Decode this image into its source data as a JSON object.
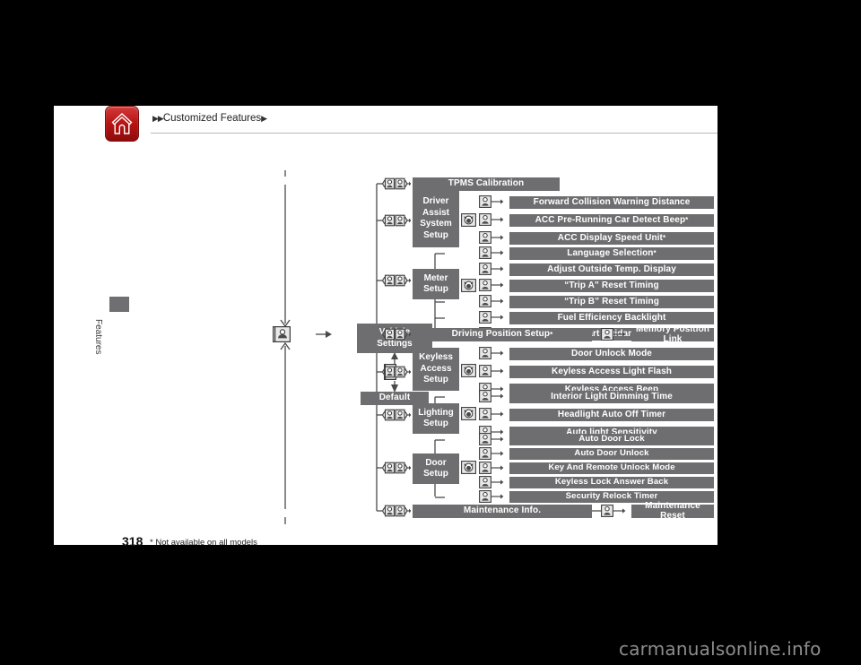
{
  "header": {
    "home_icon": "home-icon",
    "breadcrumb_prefix": "▶▶",
    "breadcrumb": "Customized Features",
    "breadcrumb_suffix": "▶"
  },
  "side_tab": {
    "label": "Features"
  },
  "footer": {
    "page_number": "318",
    "footnote": "* Not available on all models",
    "watermark": "carmanualsonline.info"
  },
  "colors": {
    "bar": "#6e6e70",
    "home_red": "#b81414",
    "line": "#4a4a4a",
    "paper": "#ffffff",
    "backdrop": "#000000"
  },
  "diagram": {
    "root": {
      "label_line1": "Vehicle",
      "label_line2": "Settings"
    },
    "default_node": {
      "label": "Default"
    },
    "branches": [
      {
        "id": "tpms",
        "type": "leaf",
        "label": "TPMS Calibration",
        "footnote_mark": ""
      },
      {
        "id": "driver-assist-system-setup",
        "type": "group",
        "label_lines": [
          "Driver",
          "Assist",
          "System",
          "Setup"
        ],
        "children": [
          {
            "label": "Forward Collision Warning Distance",
            "footnote_mark": ""
          },
          {
            "label": "ACC Pre-Running Car Detect Beep",
            "footnote_mark": "*"
          },
          {
            "label": "ACC Display Speed Unit",
            "footnote_mark": "*"
          }
        ]
      },
      {
        "id": "meter-setup",
        "type": "group",
        "label_lines": [
          "Meter",
          "Setup"
        ],
        "children": [
          {
            "label": "Language Selection",
            "footnote_mark": "*"
          },
          {
            "label": "Adjust Outside Temp. Display",
            "footnote_mark": ""
          },
          {
            "label": "“Trip A” Reset Timing",
            "footnote_mark": ""
          },
          {
            "label": "“Trip B” Reset Timing",
            "footnote_mark": ""
          },
          {
            "label": "Fuel Efficiency Backlight",
            "footnote_mark": ""
          },
          {
            "label": "Keyless Start Guidance Screens",
            "footnote_mark": ""
          }
        ]
      },
      {
        "id": "driving-position-setup",
        "type": "leaf-with-child",
        "label": "Driving Position Setup",
        "footnote_mark": "*",
        "child": {
          "label": "Memory Position Link",
          "footnote_mark": ""
        }
      },
      {
        "id": "keyless-access-setup",
        "type": "group",
        "label_lines": [
          "Keyless",
          "Access",
          "Setup"
        ],
        "children": [
          {
            "label": "Door Unlock Mode",
            "footnote_mark": ""
          },
          {
            "label": "Keyless Access Light Flash",
            "footnote_mark": ""
          },
          {
            "label": "Keyless Access Beep",
            "footnote_mark": ""
          }
        ]
      },
      {
        "id": "lighting-setup",
        "type": "group",
        "label_lines": [
          "Lighting",
          "Setup"
        ],
        "children": [
          {
            "label": "Interior Light Dimming Time",
            "footnote_mark": ""
          },
          {
            "label": "Headlight Auto Off Timer",
            "footnote_mark": ""
          },
          {
            "label": "Auto light Sensitivity",
            "footnote_mark": ""
          }
        ]
      },
      {
        "id": "door-setup",
        "type": "group",
        "label_lines": [
          "Door",
          "Setup"
        ],
        "children": [
          {
            "label": "Auto Door Lock",
            "footnote_mark": ""
          },
          {
            "label": "Auto Door Unlock",
            "footnote_mark": ""
          },
          {
            "label": "Key And Remote Unlock Mode",
            "footnote_mark": ""
          },
          {
            "label": "Keyless Lock Answer Back",
            "footnote_mark": ""
          },
          {
            "label": "Security Relock Timer",
            "footnote_mark": ""
          }
        ]
      },
      {
        "id": "maintenance-info",
        "type": "leaf-with-child",
        "label": "Maintenance Info.",
        "footnote_mark": "",
        "child": {
          "label": "Maintenance Reset",
          "footnote_mark": ""
        }
      }
    ],
    "icons": {
      "knob_dial": "knob-dial-icon",
      "enter_button": "enter-button-icon",
      "scroll_left_right": "scroll-left-right-icon",
      "arrow": "arrow-right-icon"
    }
  }
}
